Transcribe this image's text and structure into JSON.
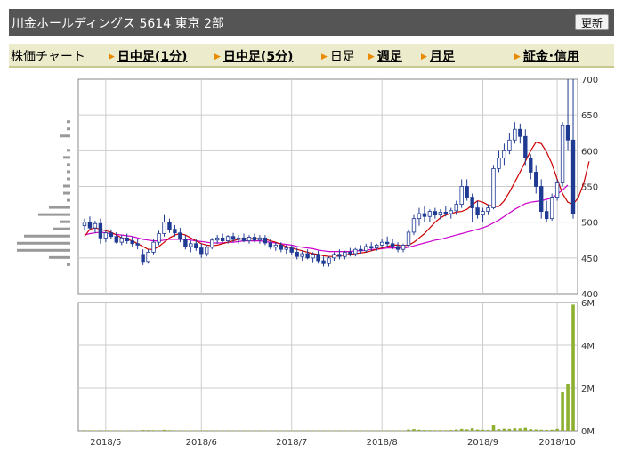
{
  "header": {
    "title": "川金ホールディングス  5614  東京 2部",
    "refresh_label": "更新"
  },
  "nav": {
    "items": [
      {
        "label": "株価チャート",
        "link": false
      },
      {
        "label": "日中足(1分)",
        "link": true
      },
      {
        "label": "日中足(5分)",
        "link": true
      },
      {
        "label": "日足",
        "link": false
      },
      {
        "label": "週足",
        "link": true
      },
      {
        "label": "月足",
        "link": true
      },
      {
        "label": "証金･信用",
        "link": true
      }
    ]
  },
  "colors": {
    "up_candle": "#ffffff",
    "down_candle": "#1f3a93",
    "ma_short": "#cc0000",
    "ma_long": "#cc00cc",
    "volume": "#8db030",
    "grid": "#cccccc",
    "price_profile": "#999999"
  },
  "chart_data": [
    {
      "type": "candlestick",
      "y_ticks": [
        "700",
        "650",
        "600",
        "550",
        "500",
        "450",
        "400"
      ],
      "ylim": [
        400,
        700
      ],
      "x_ticks": [
        "2018/5",
        "2018/6",
        "2018/7",
        "2018/8",
        "2018/9",
        "2018/10"
      ],
      "series": [
        {
          "name": "",
          "values": [
            {
              "o": 495,
              "h": 505,
              "l": 488,
              "c": 500
            },
            {
              "o": 500,
              "h": 508,
              "l": 490,
              "c": 492
            },
            {
              "o": 492,
              "h": 502,
              "l": 485,
              "c": 498
            },
            {
              "o": 498,
              "h": 505,
              "l": 470,
              "c": 478
            },
            {
              "o": 478,
              "h": 488,
              "l": 472,
              "c": 485
            },
            {
              "o": 485,
              "h": 490,
              "l": 476,
              "c": 480
            },
            {
              "o": 480,
              "h": 486,
              "l": 470,
              "c": 472
            },
            {
              "o": 472,
              "h": 482,
              "l": 468,
              "c": 478
            },
            {
              "o": 478,
              "h": 484,
              "l": 470,
              "c": 474
            },
            {
              "o": 474,
              "h": 480,
              "l": 465,
              "c": 470
            },
            {
              "o": 470,
              "h": 476,
              "l": 462,
              "c": 468
            },
            {
              "o": 455,
              "h": 462,
              "l": 440,
              "c": 445
            },
            {
              "o": 445,
              "h": 462,
              "l": 442,
              "c": 458
            },
            {
              "o": 458,
              "h": 476,
              "l": 455,
              "c": 472
            },
            {
              "o": 472,
              "h": 488,
              "l": 468,
              "c": 484
            },
            {
              "o": 484,
              "h": 510,
              "l": 480,
              "c": 500
            },
            {
              "o": 500,
              "h": 505,
              "l": 485,
              "c": 490
            },
            {
              "o": 490,
              "h": 496,
              "l": 480,
              "c": 485
            },
            {
              "o": 485,
              "h": 492,
              "l": 472,
              "c": 476
            },
            {
              "o": 476,
              "h": 482,
              "l": 462,
              "c": 466
            },
            {
              "o": 466,
              "h": 474,
              "l": 458,
              "c": 470
            },
            {
              "o": 470,
              "h": 476,
              "l": 460,
              "c": 464
            },
            {
              "o": 464,
              "h": 470,
              "l": 450,
              "c": 456
            },
            {
              "o": 456,
              "h": 468,
              "l": 452,
              "c": 465
            },
            {
              "o": 465,
              "h": 478,
              "l": 462,
              "c": 475
            },
            {
              "o": 475,
              "h": 482,
              "l": 470,
              "c": 478
            },
            {
              "o": 478,
              "h": 484,
              "l": 472,
              "c": 474
            },
            {
              "o": 474,
              "h": 482,
              "l": 470,
              "c": 480
            },
            {
              "o": 480,
              "h": 485,
              "l": 472,
              "c": 476
            },
            {
              "o": 476,
              "h": 482,
              "l": 470,
              "c": 478
            },
            {
              "o": 478,
              "h": 484,
              "l": 472,
              "c": 474
            },
            {
              "o": 474,
              "h": 482,
              "l": 470,
              "c": 479
            },
            {
              "o": 479,
              "h": 484,
              "l": 472,
              "c": 475
            },
            {
              "o": 475,
              "h": 482,
              "l": 470,
              "c": 478
            },
            {
              "o": 478,
              "h": 482,
              "l": 468,
              "c": 471
            },
            {
              "o": 471,
              "h": 476,
              "l": 462,
              "c": 465
            },
            {
              "o": 465,
              "h": 472,
              "l": 460,
              "c": 468
            },
            {
              "o": 468,
              "h": 472,
              "l": 458,
              "c": 462
            },
            {
              "o": 462,
              "h": 468,
              "l": 456,
              "c": 464
            },
            {
              "o": 464,
              "h": 468,
              "l": 454,
              "c": 458
            },
            {
              "o": 458,
              "h": 464,
              "l": 448,
              "c": 452
            },
            {
              "o": 452,
              "h": 460,
              "l": 446,
              "c": 456
            },
            {
              "o": 456,
              "h": 462,
              "l": 448,
              "c": 450
            },
            {
              "o": 450,
              "h": 458,
              "l": 444,
              "c": 455
            },
            {
              "o": 455,
              "h": 460,
              "l": 442,
              "c": 446
            },
            {
              "o": 446,
              "h": 452,
              "l": 438,
              "c": 442
            },
            {
              "o": 442,
              "h": 452,
              "l": 438,
              "c": 450
            },
            {
              "o": 450,
              "h": 458,
              "l": 446,
              "c": 455
            },
            {
              "o": 455,
              "h": 462,
              "l": 448,
              "c": 452
            },
            {
              "o": 452,
              "h": 460,
              "l": 448,
              "c": 458
            },
            {
              "o": 458,
              "h": 464,
              "l": 452,
              "c": 456
            },
            {
              "o": 456,
              "h": 464,
              "l": 452,
              "c": 462
            },
            {
              "o": 462,
              "h": 468,
              "l": 456,
              "c": 460
            },
            {
              "o": 460,
              "h": 470,
              "l": 458,
              "c": 466
            },
            {
              "o": 466,
              "h": 472,
              "l": 460,
              "c": 464
            },
            {
              "o": 464,
              "h": 470,
              "l": 460,
              "c": 468
            },
            {
              "o": 468,
              "h": 476,
              "l": 464,
              "c": 472
            },
            {
              "o": 472,
              "h": 480,
              "l": 466,
              "c": 470
            },
            {
              "o": 470,
              "h": 476,
              "l": 462,
              "c": 466
            },
            {
              "o": 466,
              "h": 472,
              "l": 458,
              "c": 462
            },
            {
              "o": 462,
              "h": 470,
              "l": 458,
              "c": 468
            },
            {
              "o": 468,
              "h": 490,
              "l": 466,
              "c": 486
            },
            {
              "o": 486,
              "h": 510,
              "l": 482,
              "c": 505
            },
            {
              "o": 505,
              "h": 520,
              "l": 495,
              "c": 512
            },
            {
              "o": 512,
              "h": 522,
              "l": 500,
              "c": 508
            },
            {
              "o": 508,
              "h": 518,
              "l": 500,
              "c": 515
            },
            {
              "o": 515,
              "h": 520,
              "l": 505,
              "c": 510
            },
            {
              "o": 510,
              "h": 518,
              "l": 504,
              "c": 514
            },
            {
              "o": 514,
              "h": 522,
              "l": 508,
              "c": 512
            },
            {
              "o": 512,
              "h": 520,
              "l": 505,
              "c": 516
            },
            {
              "o": 516,
              "h": 530,
              "l": 510,
              "c": 525
            },
            {
              "o": 525,
              "h": 560,
              "l": 520,
              "c": 550
            },
            {
              "o": 550,
              "h": 560,
              "l": 530,
              "c": 535
            },
            {
              "o": 535,
              "h": 540,
              "l": 500,
              "c": 520
            },
            {
              "o": 520,
              "h": 530,
              "l": 505,
              "c": 510
            },
            {
              "o": 510,
              "h": 520,
              "l": 500,
              "c": 515
            },
            {
              "o": 515,
              "h": 525,
              "l": 510,
              "c": 520
            },
            {
              "o": 520,
              "h": 580,
              "l": 518,
              "c": 575
            },
            {
              "o": 575,
              "h": 600,
              "l": 570,
              "c": 590
            },
            {
              "o": 590,
              "h": 610,
              "l": 580,
              "c": 600
            },
            {
              "o": 600,
              "h": 625,
              "l": 595,
              "c": 615
            },
            {
              "o": 615,
              "h": 640,
              "l": 610,
              "c": 630
            },
            {
              "o": 630,
              "h": 638,
              "l": 610,
              "c": 620
            },
            {
              "o": 620,
              "h": 630,
              "l": 580,
              "c": 590
            },
            {
              "o": 590,
              "h": 595,
              "l": 560,
              "c": 570
            },
            {
              "o": 570,
              "h": 580,
              "l": 540,
              "c": 550
            },
            {
              "o": 550,
              "h": 560,
              "l": 505,
              "c": 515
            },
            {
              "o": 515,
              "h": 530,
              "l": 500,
              "c": 505
            },
            {
              "o": 505,
              "h": 540,
              "l": 502,
              "c": 535
            },
            {
              "o": 535,
              "h": 560,
              "l": 530,
              "c": 555
            },
            {
              "o": 555,
              "h": 640,
              "l": 550,
              "c": 635
            },
            {
              "o": 635,
              "h": 700,
              "l": 600,
              "c": 615
            },
            {
              "o": 615,
              "h": 700,
              "l": 505,
              "c": 512
            }
          ]
        },
        {
          "name": "",
          "values": [
            482,
            484,
            485,
            486,
            485,
            484,
            483,
            482,
            481,
            480,
            478,
            476,
            475,
            474,
            474,
            475,
            476,
            476,
            476,
            476,
            475,
            474,
            473,
            472,
            471,
            471,
            471,
            472,
            472,
            473,
            474,
            474,
            474,
            474,
            473,
            472,
            471,
            470,
            469,
            468,
            466,
            465,
            464,
            463,
            461,
            460,
            459,
            459,
            459,
            459,
            459,
            460,
            460,
            461,
            462,
            462,
            463,
            464,
            464,
            464,
            464,
            465,
            467,
            469,
            471,
            473,
            475,
            476,
            478,
            480,
            482,
            484,
            486,
            488,
            490,
            492,
            495,
            499,
            503,
            508,
            513,
            518,
            522,
            526,
            528,
            529,
            530,
            532,
            534,
            539,
            545,
            552
          ]
        },
        {
          "name": "",
          "values": [
            480,
            490,
            492,
            490,
            488,
            486,
            482,
            478,
            476,
            474,
            470,
            466,
            462,
            462,
            466,
            472,
            478,
            482,
            484,
            482,
            478,
            474,
            470,
            468,
            467,
            468,
            470,
            472,
            474,
            476,
            477,
            477,
            477,
            477,
            476,
            474,
            472,
            469,
            466,
            464,
            462,
            460,
            458,
            456,
            455,
            453,
            452,
            452,
            453,
            454,
            455,
            456,
            457,
            458,
            460,
            462,
            464,
            466,
            468,
            468,
            467,
            468,
            472,
            478,
            484,
            492,
            500,
            506,
            510,
            512,
            514,
            515,
            518,
            524,
            530,
            528,
            524,
            522,
            522,
            530,
            542,
            556,
            570,
            585,
            600,
            612,
            610,
            598,
            582,
            560,
            540,
            528,
            525,
            535,
            555,
            585
          ]
        }
      ]
    },
    {
      "type": "bar",
      "y_ticks": [
        "6M",
        "4M",
        "2M",
        "0M"
      ],
      "ylim": [
        0,
        6000000
      ],
      "x_ticks": [
        "2018/5",
        "2018/6",
        "2018/7",
        "2018/8",
        "2018/9",
        "2018/10"
      ],
      "values": [
        30000,
        25000,
        20000,
        28000,
        22000,
        18000,
        20000,
        15000,
        18000,
        22000,
        20000,
        40000,
        35000,
        30000,
        28000,
        45000,
        30000,
        25000,
        22000,
        20000,
        18000,
        20000,
        22000,
        25000,
        20000,
        18000,
        15000,
        18000,
        16000,
        14000,
        15000,
        16000,
        14000,
        15000,
        18000,
        16000,
        14000,
        15000,
        13000,
        12000,
        14000,
        12000,
        13000,
        12000,
        14000,
        15000,
        13000,
        12000,
        14000,
        12000,
        15000,
        14000,
        16000,
        18000,
        15000,
        14000,
        16000,
        15000,
        14000,
        18000,
        20000,
        60000,
        80000,
        50000,
        40000,
        35000,
        30000,
        32000,
        30000,
        35000,
        60000,
        90000,
        70000,
        120000,
        60000,
        50000,
        45000,
        250000,
        80000,
        100000,
        90000,
        120000,
        110000,
        140000,
        80000,
        60000,
        50000,
        40000,
        50000,
        90000,
        1800000,
        2200000,
        5900000
      ]
    }
  ]
}
